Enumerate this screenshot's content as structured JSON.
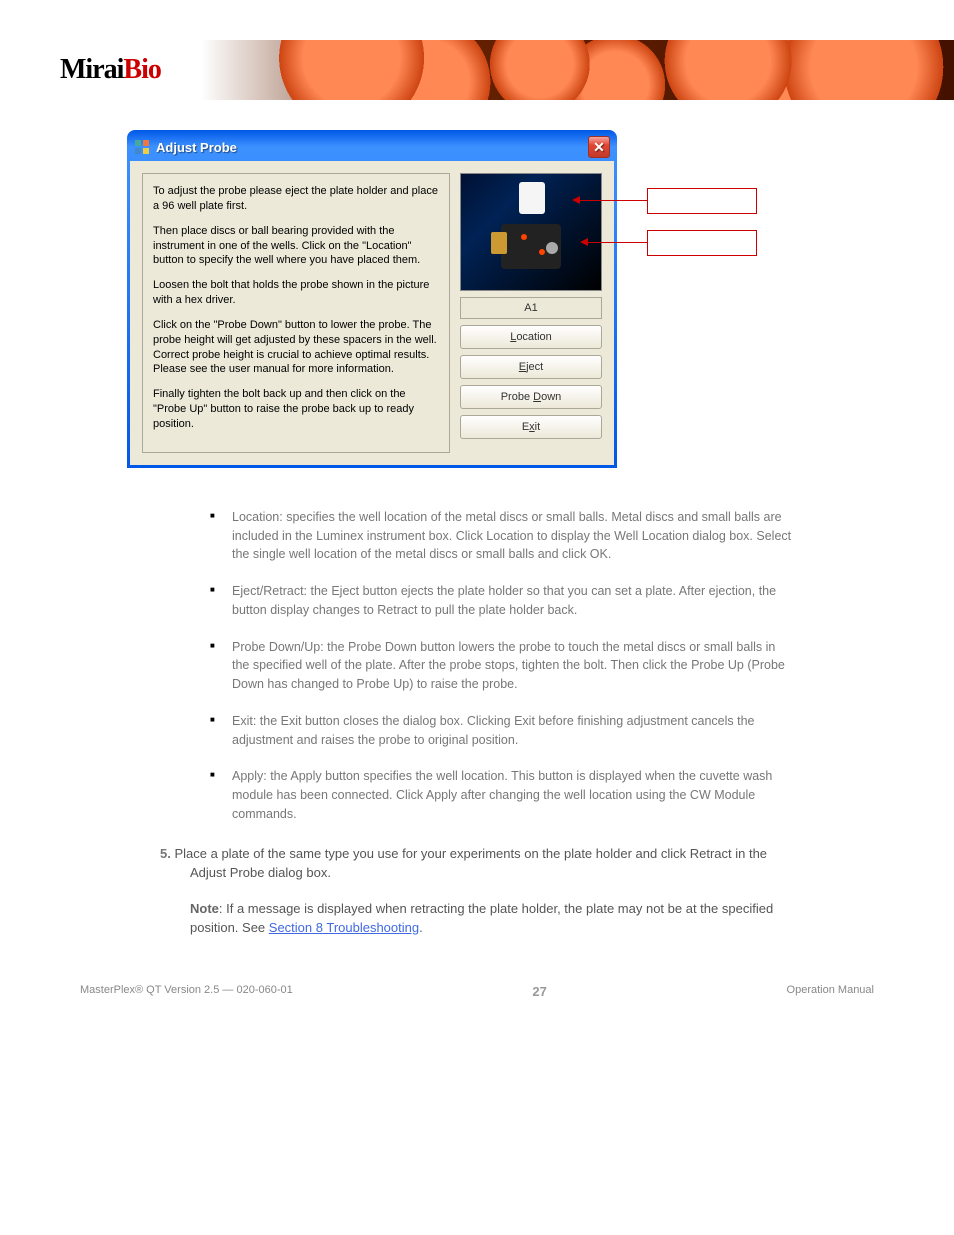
{
  "header": {
    "logo_part1": "Mirai",
    "logo_part2": "Bio"
  },
  "dialog": {
    "title": "Adjust Probe",
    "instructions": {
      "p1": "To adjust the probe please eject the plate holder and place a 96 well plate first.",
      "p2": "Then place discs or ball bearing provided with the instrument in one of the wells. Click on the \"Location\" button to specify the well where you have placed them.",
      "p3": "Loosen the bolt that holds the probe shown in the picture with a hex driver.",
      "p4": "Click on the \"Probe Down\" button to lower the probe. The probe height will get adjusted by these spacers in the well. Correct probe height is crucial to achieve optimal results. Please see the user manual for more information.",
      "p5": "Finally tighten the bolt back up and then click on the \"Probe Up\" button to raise the probe back up to ready position."
    },
    "well_display": "A1",
    "buttons": {
      "location_pre": "",
      "location_u": "L",
      "location_post": "ocation",
      "eject_pre": "",
      "eject_u": "E",
      "eject_post": "ject",
      "probedown_pre": "Probe ",
      "probedown_u": "D",
      "probedown_post": "own",
      "exit_pre": "E",
      "exit_u": "x",
      "exit_post": "it"
    }
  },
  "annotations": {
    "label1": "",
    "label2": ""
  },
  "body": {
    "list": {
      "li1": "Location: specifies the well location of the metal discs or small balls. Metal discs and small balls are included in the Luminex instrument box. Click Location to display the Well Location dialog box. Select the single well location of the metal discs or small balls and click OK.",
      "li2": "Eject/Retract: the Eject button ejects the plate holder so that you can set a plate. After ejection, the button display changes to Retract to pull the plate holder back.",
      "li3": "Probe Down/Up: the Probe Down button lowers the probe to touch the metal discs or small balls in the specified well of the plate. After the probe stops, tighten the bolt. Then click the Probe Up (Probe Down has changed to Probe Up) to raise the probe.",
      "li4": "Exit: the Exit button closes the dialog box. Clicking Exit before finishing adjustment cancels the adjustment and raises the probe to original position.",
      "li5": "Apply: the Apply button specifies the well location. This button is displayed when the cuvette wash module has been connected. Click Apply after changing the well location using the CW Module commands."
    },
    "step5_label": "5.",
    "step5_text": "Place a plate of the same type you use for your experiments on the plate holder and click Retract in the Adjust Probe dialog box.",
    "note_bold": "Note",
    "note_text": ": If a message is displayed when retracting the plate holder, the plate may not be at the specified position. See ",
    "note_link": "Section 8 Troubleshooting",
    "note_after": "."
  },
  "footer": {
    "left": "MasterPlex® QT Version 2.5 — 020-060-01",
    "page": "27",
    "right": "Operation Manual"
  }
}
